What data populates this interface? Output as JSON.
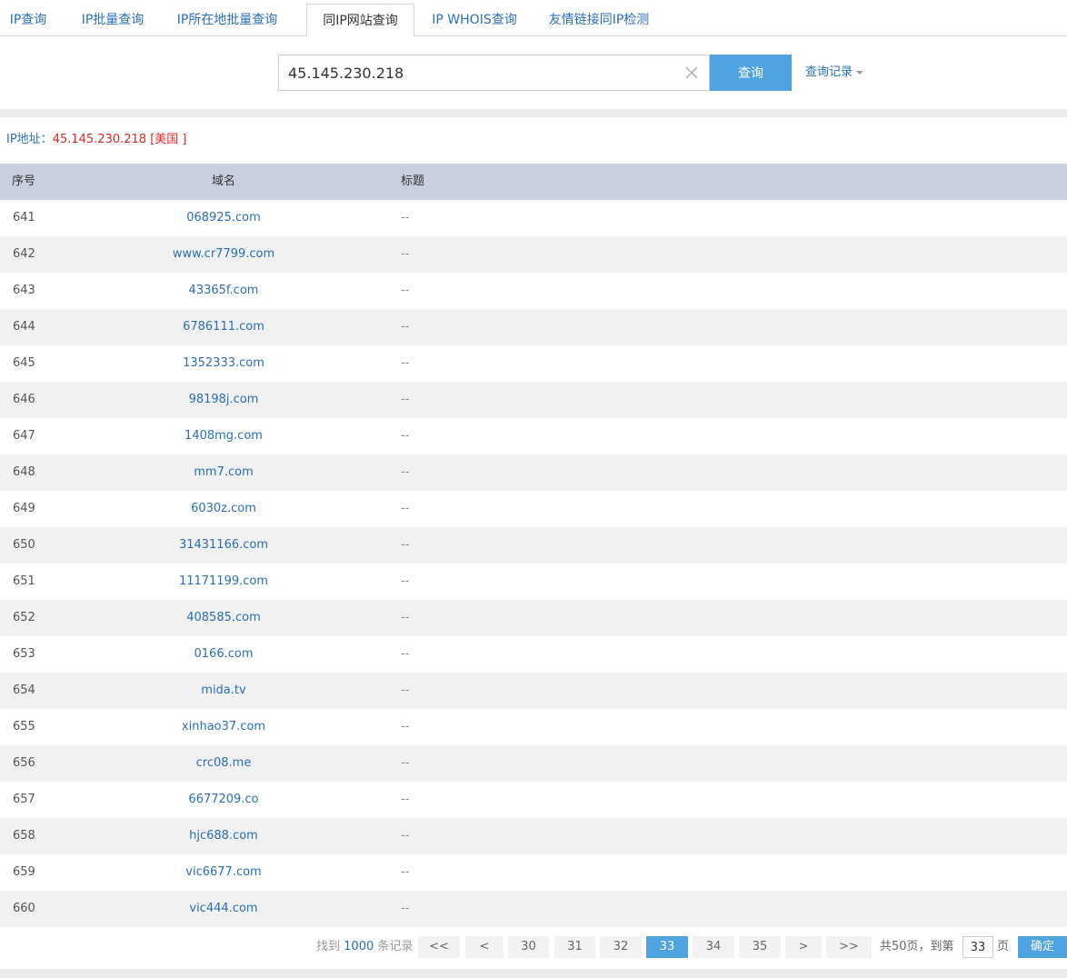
{
  "tabs": [
    {
      "label": "IP查询",
      "active": false
    },
    {
      "label": "IP批量查询",
      "active": false
    },
    {
      "label": "IP所在地批量查询",
      "active": false
    },
    {
      "label": "同IP网站查询",
      "active": true
    },
    {
      "label": "IP WHOIS查询",
      "active": false
    },
    {
      "label": "友情链接同IP检测",
      "active": false
    }
  ],
  "search": {
    "value": "45.145.230.218",
    "button_label": "查询",
    "history_label": "查询记录"
  },
  "ip_info": {
    "label": "IP地址：",
    "value": "45.145.230.218 [美国 ]"
  },
  "table": {
    "headers": {
      "no": "序号",
      "domain": "域名",
      "title": "标题"
    },
    "rows": [
      {
        "no": "641",
        "domain": "068925.com",
        "title": "--"
      },
      {
        "no": "642",
        "domain": "www.cr7799.com",
        "title": "--"
      },
      {
        "no": "643",
        "domain": "43365f.com",
        "title": "--"
      },
      {
        "no": "644",
        "domain": "6786111.com",
        "title": "--"
      },
      {
        "no": "645",
        "domain": "1352333.com",
        "title": "--"
      },
      {
        "no": "646",
        "domain": "98198j.com",
        "title": "--"
      },
      {
        "no": "647",
        "domain": "1408mg.com",
        "title": "--"
      },
      {
        "no": "648",
        "domain": "mm7.com",
        "title": "--"
      },
      {
        "no": "649",
        "domain": "6030z.com",
        "title": "--"
      },
      {
        "no": "650",
        "domain": "31431166.com",
        "title": "--"
      },
      {
        "no": "651",
        "domain": "11171199.com",
        "title": "--"
      },
      {
        "no": "652",
        "domain": "408585.com",
        "title": "--"
      },
      {
        "no": "653",
        "domain": "0166.com",
        "title": "--"
      },
      {
        "no": "654",
        "domain": "mida.tv",
        "title": "--"
      },
      {
        "no": "655",
        "domain": "xinhao37.com",
        "title": "--"
      },
      {
        "no": "656",
        "domain": "crc08.me",
        "title": "--"
      },
      {
        "no": "657",
        "domain": "6677209.co",
        "title": "--"
      },
      {
        "no": "658",
        "domain": "hjc688.com",
        "title": "--"
      },
      {
        "no": "659",
        "domain": "vic6677.com",
        "title": "--"
      },
      {
        "no": "660",
        "domain": "vic444.com",
        "title": "--"
      }
    ]
  },
  "pagination": {
    "found_prefix": "找到",
    "found_count": "1000",
    "found_suffix": "条记录",
    "first": "<<",
    "prev": "<",
    "pages": [
      "30",
      "31",
      "32",
      "33",
      "34",
      "35"
    ],
    "current": "33",
    "next": ">",
    "last": ">>",
    "total_text": "共50页，到第",
    "goto_value": "33",
    "page_suffix": "页",
    "confirm_label": "确定"
  },
  "colors": {
    "accent": "#4fa3e0",
    "link": "#2a6fb6",
    "ip_value": "#d42a2a",
    "header_bg": "#c9cfde"
  },
  "icons": {
    "clear": "close-icon",
    "history": "caret-down-icon"
  }
}
